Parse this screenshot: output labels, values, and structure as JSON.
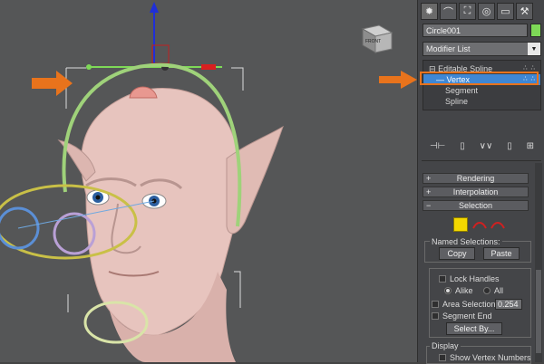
{
  "toolbar_tabs": [
    {
      "icon": "sun-icon",
      "glyph": "✹",
      "active": true
    },
    {
      "icon": "modify-icon",
      "glyph": "⌒",
      "active": false
    },
    {
      "icon": "hierarchy-icon",
      "glyph": "⛶",
      "active": false
    },
    {
      "icon": "motion-icon",
      "glyph": "◎",
      "active": false
    },
    {
      "icon": "display-icon",
      "glyph": "▭",
      "active": false
    },
    {
      "icon": "utilities-icon",
      "glyph": "⚒",
      "active": false
    }
  ],
  "object": {
    "name": "Circle001",
    "color": "#7ed957"
  },
  "modifier_list": {
    "label": "Modifier List"
  },
  "stack": {
    "items": [
      {
        "label": "Editable Spline",
        "selected": false,
        "indent": 0
      },
      {
        "label": "Vertex",
        "selected": true,
        "indent": 1
      },
      {
        "label": "Segment",
        "selected": false,
        "indent": 1
      },
      {
        "label": "Spline",
        "selected": false,
        "indent": 1
      }
    ],
    "dots": "∴ ∴"
  },
  "stack_tools": [
    "⊣⊢",
    "▯",
    "∨∨",
    "▯",
    "⊞"
  ],
  "rollouts": {
    "rendering": {
      "label": "Rendering",
      "sign": "+"
    },
    "interpolation": {
      "label": "Interpolation",
      "sign": "+"
    },
    "selection": {
      "label": "Selection",
      "sign": "−"
    }
  },
  "named_selections": {
    "title": "Named Selections:",
    "copy": "Copy",
    "paste": "Paste"
  },
  "options": {
    "lock_handles": "Lock Handles",
    "alike": "Alike",
    "all": "All",
    "area_selection": "Area Selection:",
    "area_value": "0.254",
    "segment_end": "Segment End",
    "select_by": "Select By..."
  },
  "display": {
    "title": "Display",
    "show_vertex_numbers": "Show Vertex Numbers"
  },
  "viewcube": {
    "label": "FRONT"
  },
  "colors": {
    "accent_orange": "#e8731c",
    "selection_blue": "#3f87d4",
    "viewport_bg": "#555657"
  }
}
